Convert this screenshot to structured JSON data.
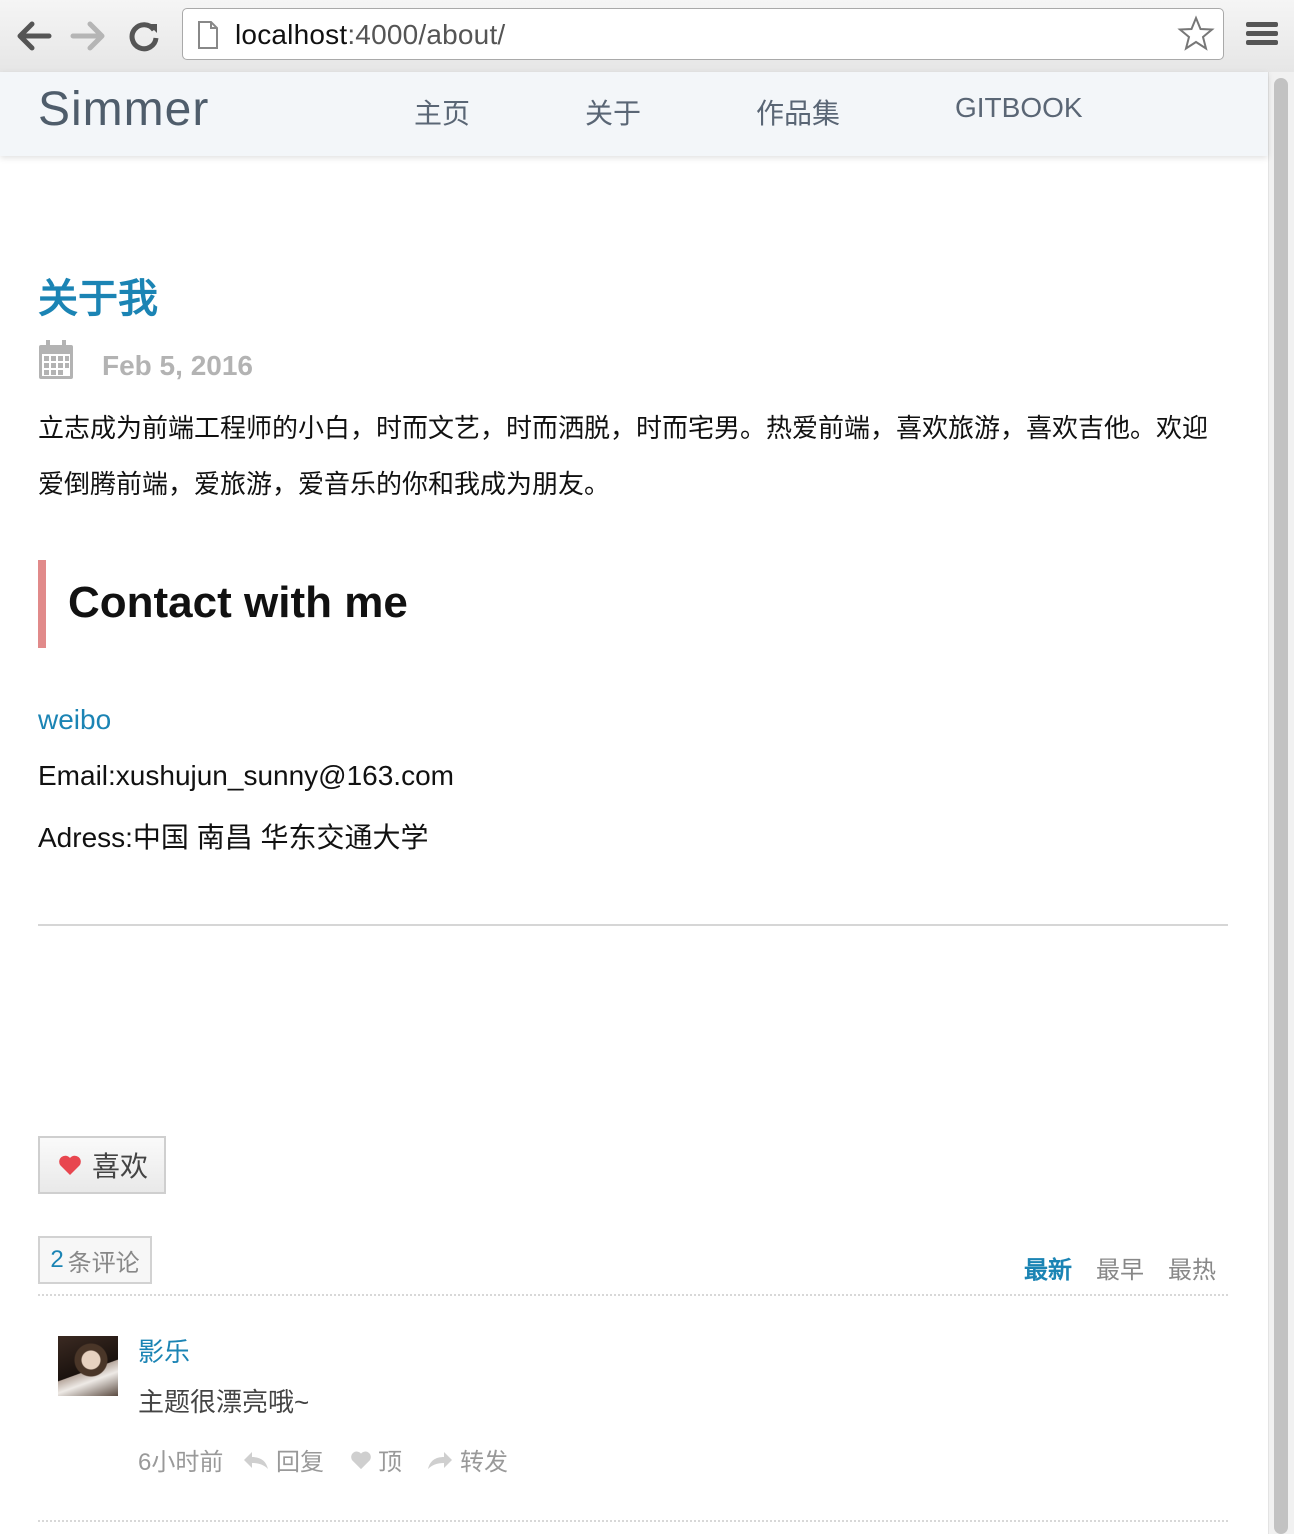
{
  "browser": {
    "url_host": "localhost",
    "url_rest": ":4000/about/"
  },
  "site": {
    "brand": "Simmer",
    "menu": [
      "主页",
      "关于",
      "作品集",
      "GITBOOK"
    ]
  },
  "post": {
    "title": "关于我",
    "date": "Feb 5, 2016",
    "intro": "立志成为前端工程师的小白，时而文艺，时而洒脱，时而宅男。热爱前端，喜欢旅游，喜欢吉他。欢迎爱倒腾前端，爱旅游，爱音乐的你和我成为朋友。",
    "contact_heading": "Contact with me",
    "weibo": "weibo",
    "email": "Email:xushujun_sunny@163.com",
    "address": "Adress:中国 南昌 华东交通大学"
  },
  "comments": {
    "like_label": "喜欢",
    "count": "2",
    "count_suffix": "条评论",
    "sort": [
      "最新",
      "最早",
      "最热"
    ],
    "items": [
      {
        "author": "影乐",
        "text": "主题很漂亮哦~",
        "time": "6小时前",
        "reply": "回复",
        "up": "顶",
        "share": "转发"
      }
    ]
  },
  "colors": {
    "accent": "#1b84b4",
    "quote_border": "#e18a8a"
  }
}
